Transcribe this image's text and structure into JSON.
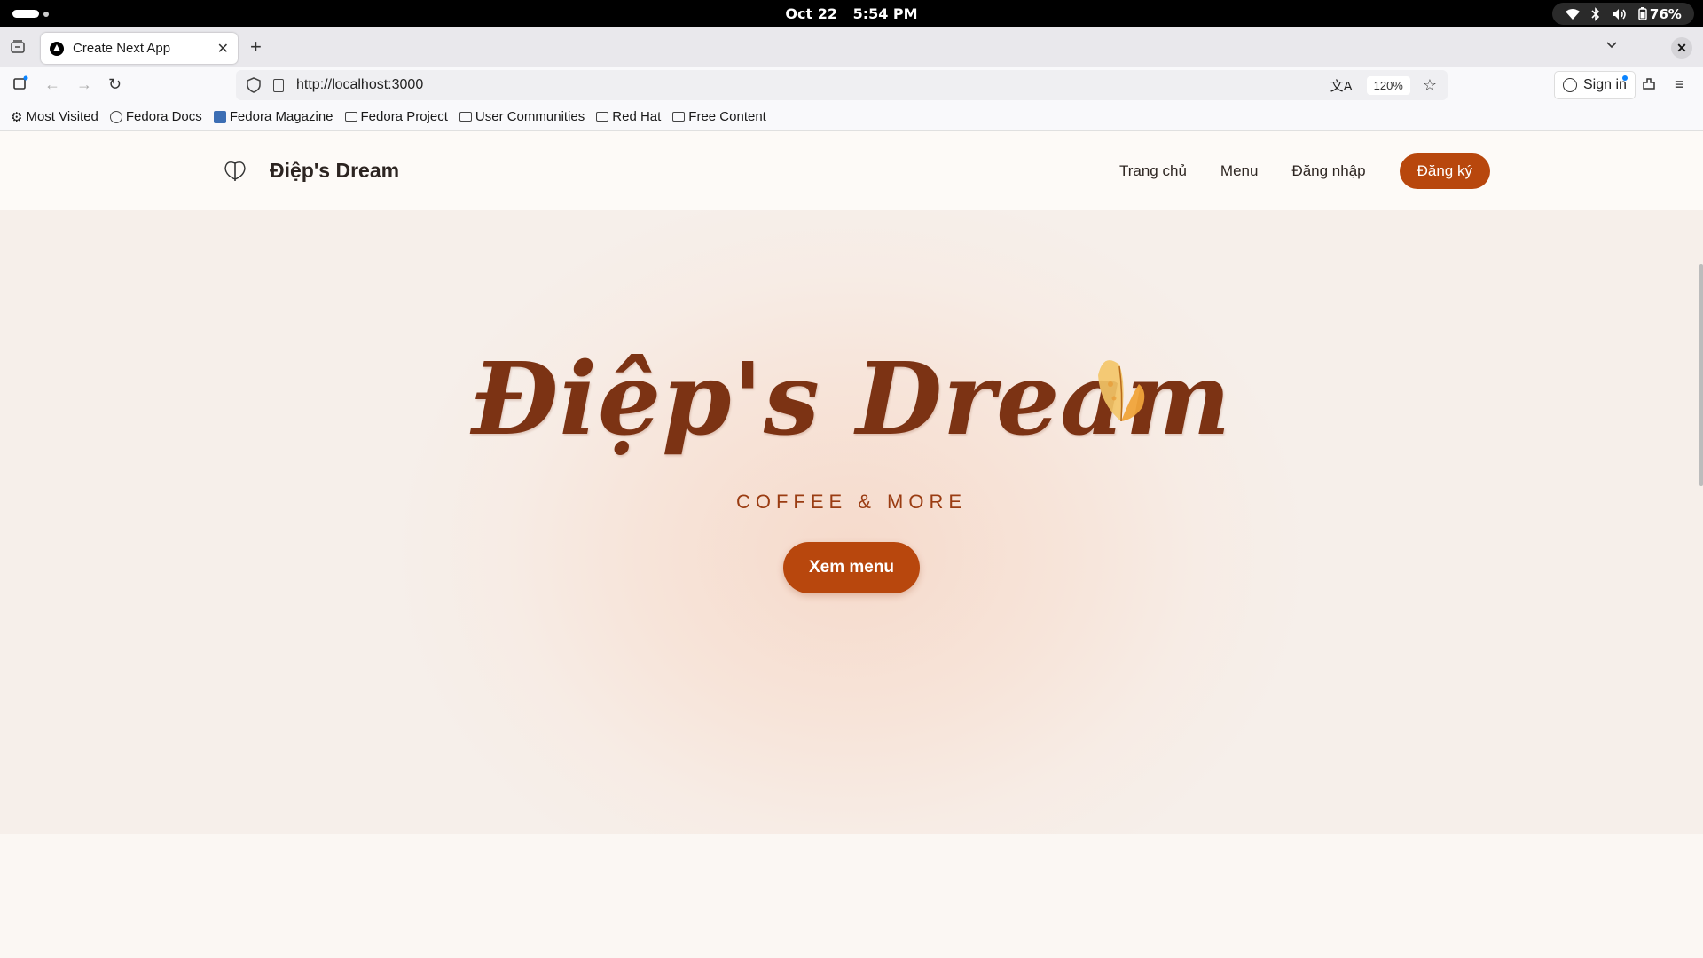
{
  "system": {
    "date": "Oct 22",
    "time": "5:54 PM",
    "language": "en",
    "battery": "76%"
  },
  "browser": {
    "tab_title": "Create Next App",
    "url": "http://localhost:3000",
    "zoom": "120%",
    "signin_label": "Sign in",
    "bookmarks": [
      "Most Visited",
      "Fedora Docs",
      "Fedora Magazine",
      "Fedora Project",
      "User Communities",
      "Red Hat",
      "Free Content"
    ]
  },
  "site": {
    "brand": "Điệp's Dream",
    "nav": {
      "home": "Trang chủ",
      "menu": "Menu",
      "login": "Đăng nhập",
      "signup": "Đăng ký"
    },
    "hero": {
      "title": "Điệp's Dream",
      "tagline": "COFFEE & MORE",
      "cta": "Xem menu"
    },
    "colors": {
      "accent": "#b8470d",
      "title": "#7c3314",
      "background": "#fbf7f3"
    }
  }
}
